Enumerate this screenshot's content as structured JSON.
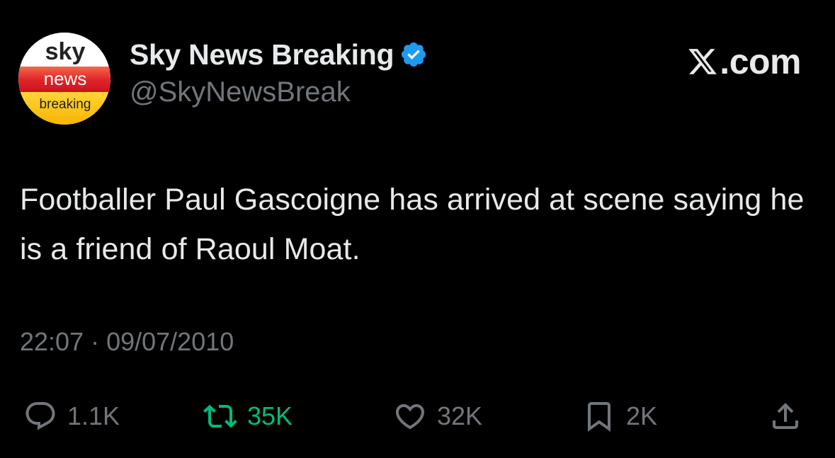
{
  "author": {
    "display_name": "Sky News Breaking",
    "handle": "@SkyNewsBreak",
    "verified": true,
    "avatar": {
      "line1": "sky",
      "line2": "news",
      "line3": "breaking"
    }
  },
  "brand": {
    "text": ".com",
    "icon": "x-logo-icon"
  },
  "tweet": {
    "text": "Footballer Paul Gascoigne has arrived at scene saying he is a friend of Raoul Moat.",
    "timestamp": "22:07 · 09/07/2010"
  },
  "actions": {
    "reply": {
      "count": "1.1K",
      "icon": "reply-icon"
    },
    "retweet": {
      "count": "35K",
      "icon": "retweet-icon"
    },
    "like": {
      "count": "32K",
      "icon": "heart-icon"
    },
    "bookmark": {
      "count": "2K",
      "icon": "bookmark-icon"
    },
    "share": {
      "icon": "share-icon"
    }
  },
  "colors": {
    "background": "#000000",
    "primary_text": "#e7e9ea",
    "secondary_text": "#71767b",
    "verified_blue": "#1d9bf0",
    "retweet_green": "#00ba7c"
  }
}
